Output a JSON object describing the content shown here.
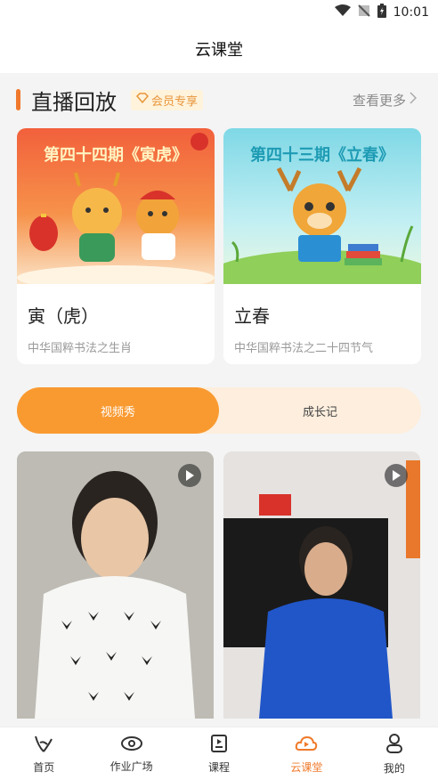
{
  "status_bar": {
    "time": "10:01",
    "icons": [
      "wifi-icon",
      "no-signal-icon",
      "battery-charging-icon"
    ]
  },
  "header": {
    "title": "云课堂"
  },
  "section": {
    "title": "直播回放",
    "badge": "会员专享",
    "more": "查看更多"
  },
  "replays": [
    {
      "banner": "第四十四期《寅虎》",
      "title": "寅（虎）",
      "subtitle": "中华国粹书法之生肖"
    },
    {
      "banner": "第四十三期《立春》",
      "title": "立春",
      "subtitle": "中华国粹书法之二十四节气"
    }
  ],
  "tabs": [
    {
      "label": "视频秀",
      "active": true
    },
    {
      "label": "成长记",
      "active": false
    }
  ],
  "nav": [
    {
      "label": "首页",
      "icon": "home-icon",
      "active": false
    },
    {
      "label": "作业广场",
      "icon": "eye-icon",
      "active": false
    },
    {
      "label": "课程",
      "icon": "book-icon",
      "active": false
    },
    {
      "label": "云课堂",
      "icon": "cloud-class-icon",
      "active": true
    },
    {
      "label": "我的",
      "icon": "profile-icon",
      "active": false
    }
  ],
  "colors": {
    "accent": "#f0782c",
    "tab_active": "#f99a30",
    "tab_bg": "#fdeedd"
  }
}
